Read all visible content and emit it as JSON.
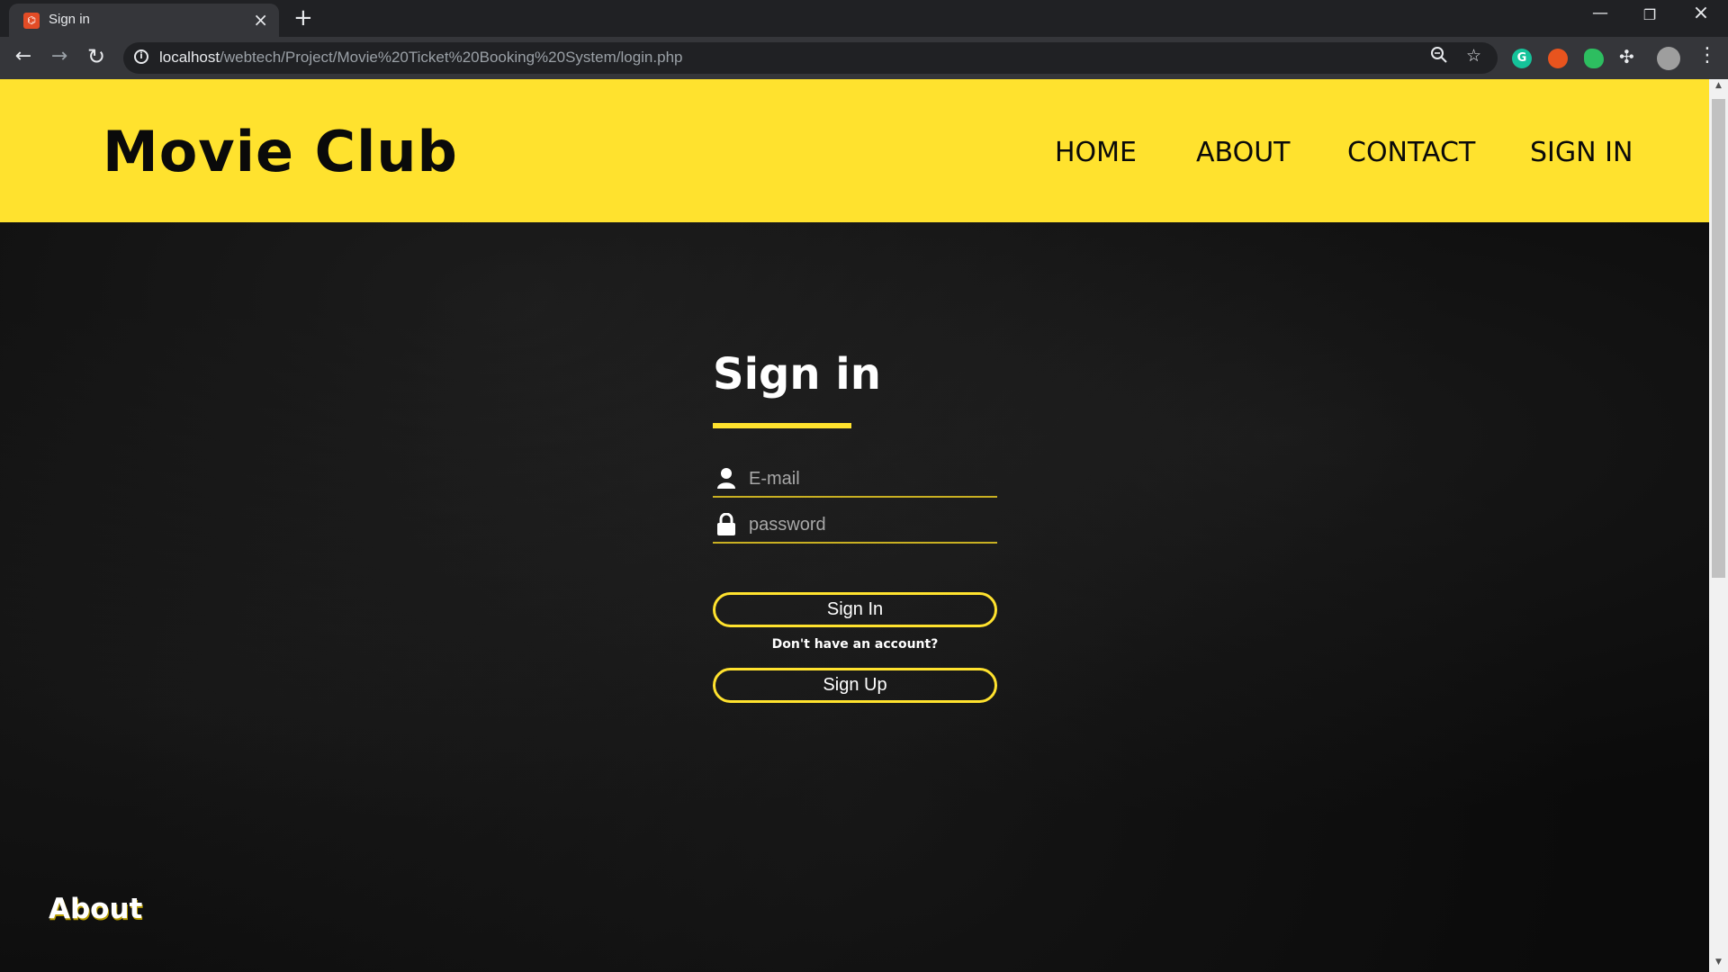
{
  "browser": {
    "tab_title": "Sign in",
    "url_host": "localhost",
    "url_path": "/webtech/Project/Movie%20Ticket%20Booking%20System/login.php"
  },
  "header": {
    "logo": "Movie Club",
    "nav": {
      "home": "HOME",
      "about": "ABOUT",
      "contact": "CONTACT",
      "signin": "SIGN IN"
    },
    "background_color": "#ffe22e"
  },
  "form": {
    "title": "Sign in",
    "email_placeholder": "E-mail",
    "password_placeholder": "password",
    "signin_button": "Sign In",
    "no_account_text": "Don't have an account?",
    "signup_button": "Sign Up",
    "accent_color": "#ffe22e"
  },
  "footer": {
    "about_heading": "About"
  },
  "icons": {
    "email_field": "user-icon",
    "password_field": "lock-icon"
  }
}
